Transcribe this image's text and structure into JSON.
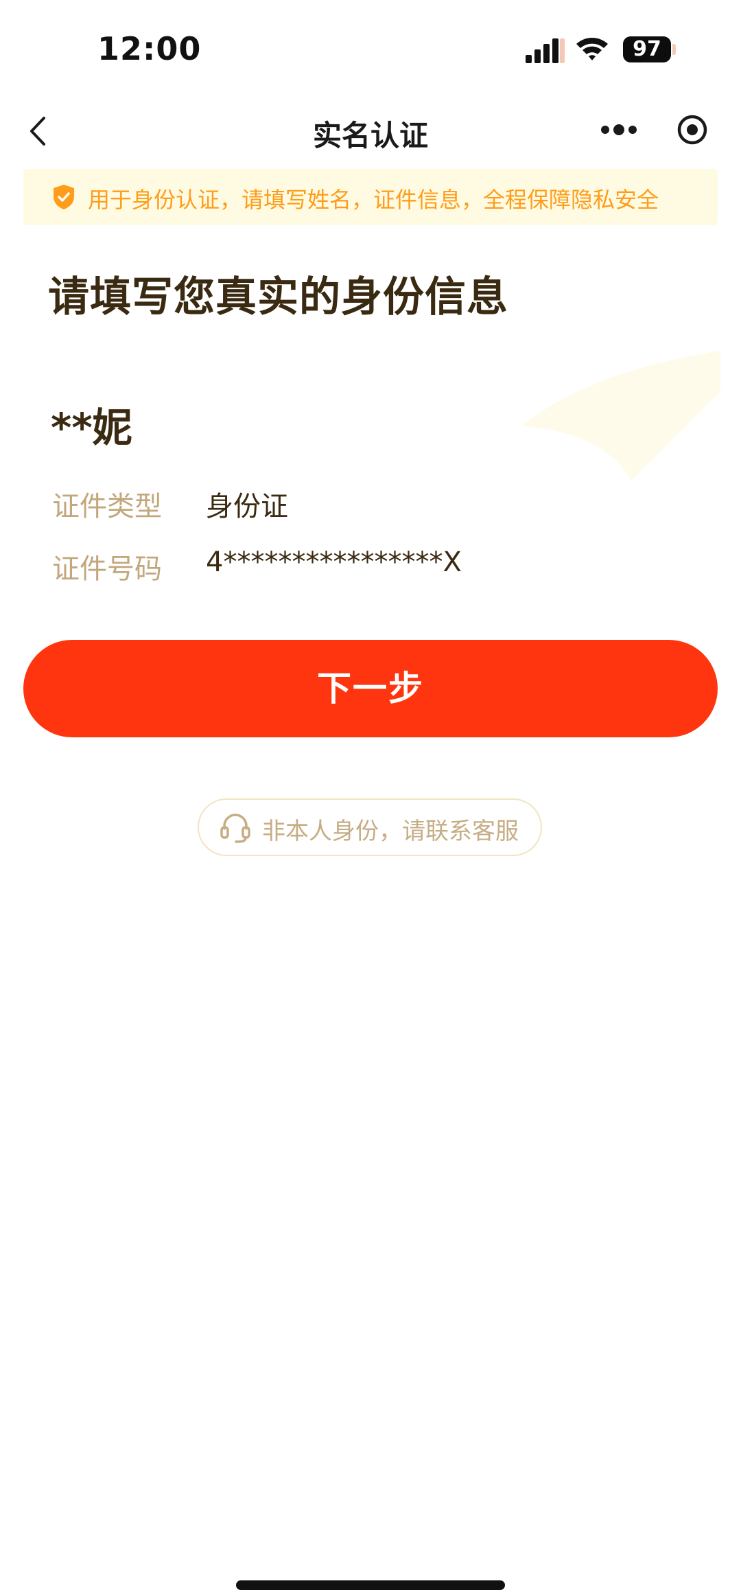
{
  "status_bar": {
    "time": "12:00",
    "battery": "97",
    "icons": [
      "cellular-signal-icon",
      "wifi-icon",
      "battery-icon"
    ]
  },
  "nav": {
    "title": "实名认证",
    "icons": [
      "back-icon",
      "more-icon",
      "record-icon"
    ]
  },
  "notice": {
    "text": "用于身份认证，请填写姓名，证件信息，全程保障隐私安全",
    "icon": "shield-check-icon"
  },
  "main": {
    "title": "请填写您真实的身份信息",
    "name": "**妮",
    "fields": [
      {
        "label": "证件类型",
        "value": "身份证"
      },
      {
        "label": "证件号码",
        "value": "4****************X"
      }
    ]
  },
  "actions": {
    "next_label": "下一步",
    "support_label": "非本人身份，请联系客服",
    "support_icon": "headset-icon"
  },
  "colors": {
    "accent": "#ff350f",
    "notice_bg": "#fffbe2",
    "notice_text": "#ff9c19",
    "label": "#c2a77c",
    "text": "#3a2a12"
  }
}
